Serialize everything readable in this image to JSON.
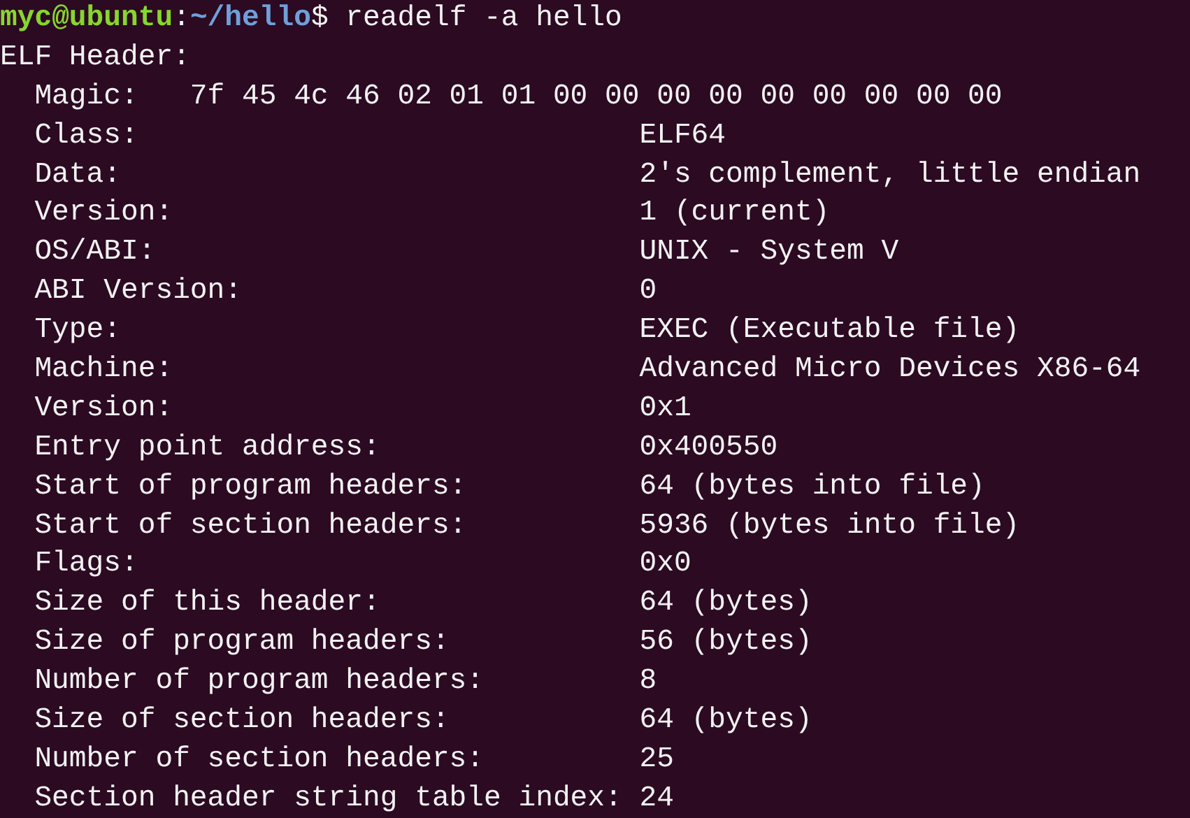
{
  "prompt": {
    "user_host": "myc@ubuntu",
    "separator": ":",
    "path": "~/hello",
    "symbol": "$",
    "command": "readelf -a hello"
  },
  "section_title": "ELF Header:",
  "magic": {
    "label": "Magic:",
    "value": "7f 45 4c 46 02 01 01 00 00 00 00 00 00 00 00 00"
  },
  "fields": [
    {
      "label": "Class:",
      "value": "ELF64"
    },
    {
      "label": "Data:",
      "value": "2's complement, little endian"
    },
    {
      "label": "Version:",
      "value": "1 (current)"
    },
    {
      "label": "OS/ABI:",
      "value": "UNIX - System V"
    },
    {
      "label": "ABI Version:",
      "value": "0"
    },
    {
      "label": "Type:",
      "value": "EXEC (Executable file)"
    },
    {
      "label": "Machine:",
      "value": "Advanced Micro Devices X86-64"
    },
    {
      "label": "Version:",
      "value": "0x1"
    },
    {
      "label": "Entry point address:",
      "value": "0x400550"
    },
    {
      "label": "Start of program headers:",
      "value": "64 (bytes into file)"
    },
    {
      "label": "Start of section headers:",
      "value": "5936 (bytes into file)"
    },
    {
      "label": "Flags:",
      "value": "0x0"
    },
    {
      "label": "Size of this header:",
      "value": "64 (bytes)"
    },
    {
      "label": "Size of program headers:",
      "value": "56 (bytes)"
    },
    {
      "label": "Number of program headers:",
      "value": "8"
    },
    {
      "label": "Size of section headers:",
      "value": "64 (bytes)"
    },
    {
      "label": "Number of section headers:",
      "value": "25"
    },
    {
      "label": "Section header string table index:",
      "value": "24"
    }
  ]
}
